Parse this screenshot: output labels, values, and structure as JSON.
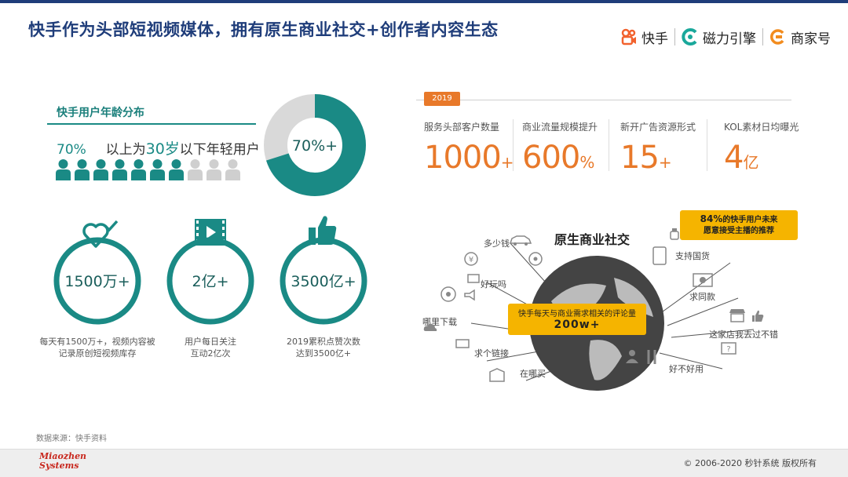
{
  "title": "快手作为头部短视频媒体，拥有原生商业社交+创作者内容生态",
  "brands": [
    "快手",
    "磁力引擎",
    "商家号"
  ],
  "age": {
    "title": "快手用户年龄分布",
    "pct": "70%",
    "text_a": "以上为",
    "text_num": "30岁",
    "text_b": "以下年轻用户",
    "donut_label": "70%+",
    "donut_share": 0.7,
    "people_total": 10,
    "people_highlight": 7
  },
  "rings": [
    {
      "value": "1500万+",
      "caption": [
        "每天有1500万+，视频内容被",
        "记录原创短视频库存"
      ],
      "icon": "heart-check-icon"
    },
    {
      "value": "2亿+",
      "caption": [
        "用户每日关注",
        "互动2亿次"
      ],
      "icon": "video-play-icon"
    },
    {
      "value": "3500亿+",
      "caption": [
        "2019累积点赞次数",
        "达到3500亿+"
      ],
      "icon": "thumbs-up-icon"
    }
  ],
  "stats_year": "2019",
  "stats": [
    {
      "label": "服务头部客户数量",
      "value": "1000",
      "unit": "+"
    },
    {
      "label": "商业流量规模提升",
      "value": "600",
      "unit": "%"
    },
    {
      "label": "新开广告资源形式",
      "value": "15",
      "unit": "+"
    },
    {
      "label": "KOL素材日均曝光",
      "value": "4",
      "unit": "亿"
    }
  ],
  "social": {
    "title": "原生商业社交",
    "banner_line1": "快手每天与商业需求相关的评论量",
    "banner_line2": "200w+",
    "callout_pct": "84%",
    "callout_line1": "的快手用户未来",
    "callout_line2": "愿意接受主播的推荐",
    "labels": [
      "多少钱",
      "好玩吗",
      "哪里下载",
      "求个链接",
      "在哪买",
      "支持国货",
      "求同款",
      "这家店我去过不错",
      "好不好用"
    ]
  },
  "source": "数据来源：快手资料",
  "logo_line1": "Miaozhen",
  "logo_line2": "Systems",
  "copyright": "© 2006-2020 秒针系统 版权所有",
  "colors": {
    "teal": "#1a8a85",
    "orange": "#e8792a",
    "yellow": "#f5b400",
    "navy": "#1f3d7a"
  }
}
